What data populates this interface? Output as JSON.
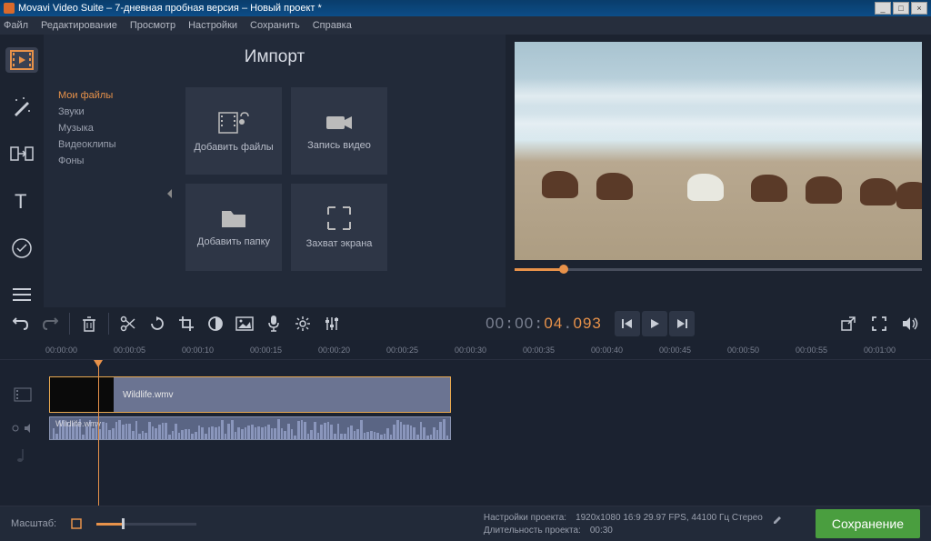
{
  "titlebar": {
    "app": "Movavi Video Suite",
    "suffix": " – 7-дневная пробная версия – Новый проект *"
  },
  "menubar": [
    "Файл",
    "Редактирование",
    "Просмотр",
    "Настройки",
    "Сохранить",
    "Справка"
  ],
  "import": {
    "title": "Импорт",
    "categories": [
      "Мои файлы",
      "Звуки",
      "Музыка",
      "Видеоклипы",
      "Фоны"
    ],
    "active_category": 0,
    "tiles": {
      "add_files": "Добавить файлы",
      "record_video": "Запись видео",
      "add_folder": "Добавить папку",
      "screen_capture": "Захват экрана"
    }
  },
  "timecode": {
    "hh": "00",
    "mm": "00",
    "ss": "04",
    "ms": "093"
  },
  "ruler_ticks": [
    "00:00:00",
    "00:00:05",
    "00:00:10",
    "00:00:15",
    "00:00:20",
    "00:00:25",
    "00:00:30",
    "00:00:35",
    "00:00:40",
    "00:00:45",
    "00:00:50",
    "00:00:55",
    "00:01:00"
  ],
  "clips": {
    "video": "Wildlife.wmv",
    "audio": "Wildlife.wmv"
  },
  "bottom": {
    "zoom_label": "Масштаб:",
    "settings_label": "Настройки проекта:",
    "settings_value": "1920x1080 16:9 29.97 FPS, 44100 Гц Cтерео",
    "duration_label": "Длительность проекта:",
    "duration_value": "00:30",
    "save": "Сохранение"
  }
}
